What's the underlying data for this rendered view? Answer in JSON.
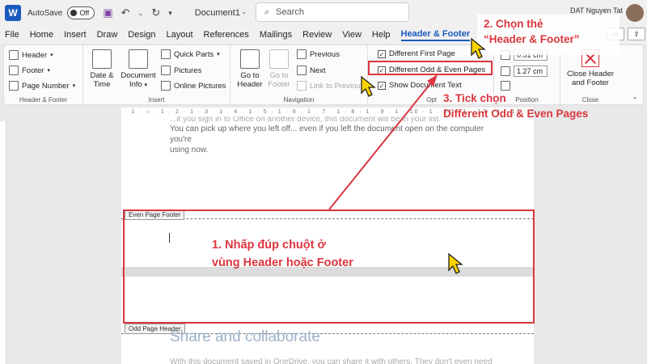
{
  "titlebar": {
    "autosave_label": "AutoSave",
    "autosave_state": "Off",
    "doc_title": "Document1",
    "doc_title_sep": "-",
    "search_placeholder": "Search",
    "user_name": "DAT Nguyen Tat"
  },
  "menu": {
    "items": [
      "File",
      "Home",
      "Insert",
      "Draw",
      "Design",
      "Layout",
      "References",
      "Mailings",
      "Review",
      "View",
      "Help"
    ],
    "active": "Header & Footer"
  },
  "ribbon": {
    "header_footer": {
      "header": "Header",
      "footer": "Footer",
      "page_number": "Page Number",
      "label": "Header & Footer"
    },
    "insert": {
      "date_time": [
        "Date &",
        "Time"
      ],
      "doc_info": [
        "Document",
        "Info"
      ],
      "quick_parts": "Quick Parts",
      "pictures": "Pictures",
      "online_pictures": "Online Pictures",
      "label": "Insert"
    },
    "navigation": {
      "goto_header": [
        "Go to",
        "Header"
      ],
      "goto_footer": [
        "Go to",
        "Footer"
      ],
      "previous": "Previous",
      "next": "Next",
      "link_previous": "Link to Previous",
      "label": "Navigation"
    },
    "options": {
      "first_page": "Different First Page",
      "odd_even": "Different Odd & Even Pages",
      "show_text": "Show Document Text",
      "label": "Opt"
    },
    "position": {
      "header_dist": "0.51 cm",
      "footer_dist": "1.27 cm",
      "label": "Position"
    },
    "close": {
      "btn": [
        "Close Header",
        "and Footer"
      ],
      "label": "Close"
    }
  },
  "document": {
    "ruler_text": "· 1 · ⌂ · 1 · 2 · 1 · 3 · 1 · 4 · 1 · 5 · 1 · 6 · 1 · 7 · 1 · 8 · 1 · 9 · 1 · 10 · 1 · 11 · 1 · 12 · 1 · 13 · 1 · 14 · 1 · 15",
    "text_line1": "...if you sign in to Office on another device, this document will be in your list.",
    "text_line2": "You can pick up where you left off... even if you left the document open on the computer you're",
    "text_line3": "using now.",
    "even_footer_tag": "Even Page Footer",
    "odd_header_tag": "Odd Page Header",
    "heading": "Share and collaborate",
    "bottom_text": "With this document saved in OneDrive, you can share it with others. They don't even need Word"
  },
  "annotations": {
    "step1_line1": "1. Nhấp đúp chuột ở",
    "step1_line2": "vùng Header hoặc Footer",
    "step2_line1": "2. Chọn thẻ",
    "step2_line2": "“Header & Footer”",
    "step3_line1": "3. Tick chọn",
    "step3_line2": "Different Odd & Even Pages"
  },
  "colors": {
    "accent": "#185abd",
    "annotation_red": "#d9363e",
    "cursor_yellow": "#ffd400"
  }
}
